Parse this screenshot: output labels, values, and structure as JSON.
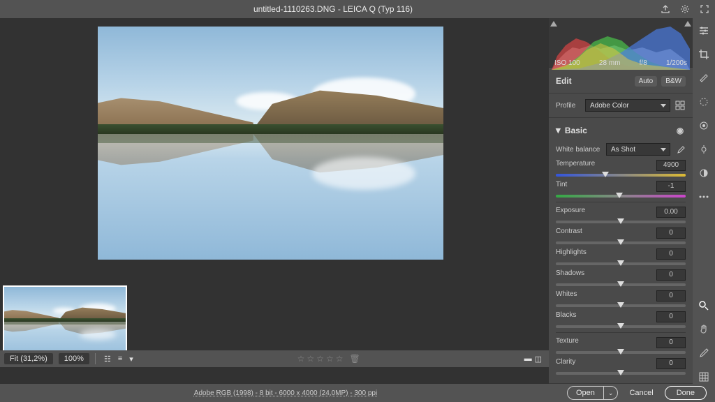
{
  "title": "untitled-1110263.DNG  -  LEICA Q (Typ 116)",
  "metadata": {
    "iso": "ISO 100",
    "focal": "28 mm",
    "aperture": "f/8",
    "shutter": "1/200s"
  },
  "edit": {
    "label": "Edit",
    "auto": "Auto",
    "bw": "B&W"
  },
  "profile": {
    "label": "Profile",
    "value": "Adobe Color"
  },
  "basic": {
    "label": "Basic",
    "wb_label": "White balance",
    "wb_value": "As Shot",
    "temperature": {
      "label": "Temperature",
      "value": "4900",
      "pos": 38
    },
    "tint": {
      "label": "Tint",
      "value": "-1",
      "pos": 49
    },
    "exposure": {
      "label": "Exposure",
      "value": "0.00",
      "pos": 50
    },
    "contrast": {
      "label": "Contrast",
      "value": "0",
      "pos": 50
    },
    "highlights": {
      "label": "Highlights",
      "value": "0",
      "pos": 50
    },
    "shadows": {
      "label": "Shadows",
      "value": "0",
      "pos": 50
    },
    "whites": {
      "label": "Whites",
      "value": "0",
      "pos": 50
    },
    "blacks": {
      "label": "Blacks",
      "value": "0",
      "pos": 50
    },
    "texture": {
      "label": "Texture",
      "value": "0",
      "pos": 50
    },
    "clarity": {
      "label": "Clarity",
      "value": "0",
      "pos": 50
    }
  },
  "zoom": {
    "fit_label": "Fit (31,2%)",
    "pct": "100%"
  },
  "file_info": "Adobe RGB (1998) - 8 bit - 6000 x 4000 (24,0MP) - 300 ppi",
  "buttons": {
    "open": "Open",
    "cancel": "Cancel",
    "done": "Done"
  }
}
